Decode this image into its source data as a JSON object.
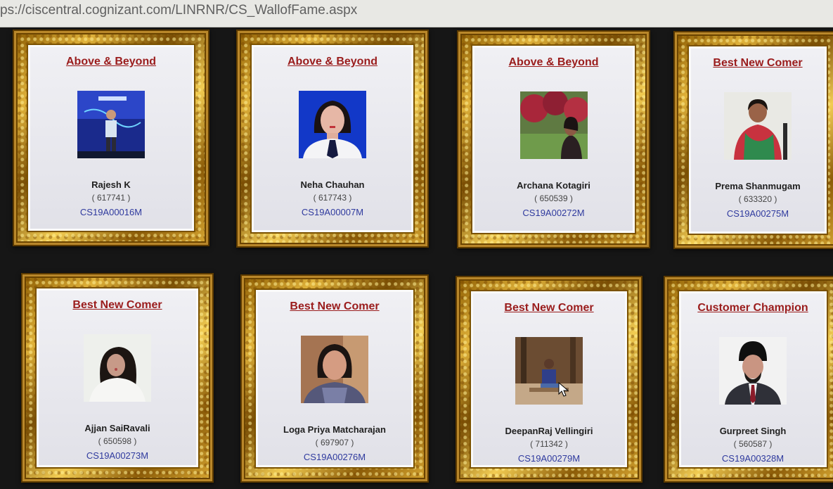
{
  "browser": {
    "url": "ps://ciscentral.cognizant.com/LINRNR/CS_WallofFame.aspx"
  },
  "wall_of_fame": {
    "cards": [
      {
        "award": "Above & Beyond",
        "name": "Rajesh K",
        "emp_id": "( 617741 )",
        "code": "CS19A00016M",
        "photo": "photo-stage"
      },
      {
        "award": "Above & Beyond",
        "name": "Neha Chauhan",
        "emp_id": "( 617743 )",
        "code": "CS19A00007M",
        "photo": "photo-portrait-blue"
      },
      {
        "award": "Above & Beyond",
        "name": "Archana Kotagiri",
        "emp_id": "( 650539 )",
        "code": "CS19A00272M",
        "photo": "photo-garden"
      },
      {
        "award": "Best New Comer",
        "name": "Prema Shanmugam",
        "emp_id": "( 633320 )",
        "code": "CS19A00275M",
        "photo": "photo-saree"
      },
      {
        "award": "Best New Comer",
        "name": "Ajjan SaiRavali",
        "emp_id": "( 650598 )",
        "code": "CS19A00273M",
        "photo": "photo-selfie"
      },
      {
        "award": "Best New Comer",
        "name": "Loga Priya Matcharajan",
        "emp_id": "( 697907 )",
        "code": "CS19A00276M",
        "photo": "photo-portrait-brown"
      },
      {
        "award": "Best New Comer",
        "name": "DeepanRaj Vellingiri",
        "emp_id": "( 711342 )",
        "code": "CS19A00279M",
        "photo": "photo-outdoor-seated"
      },
      {
        "award": "Customer Champion",
        "name": "Gurpreet Singh",
        "emp_id": "( 560587 )",
        "code": "CS19A00328M",
        "photo": "photo-portrait-turban"
      }
    ]
  }
}
